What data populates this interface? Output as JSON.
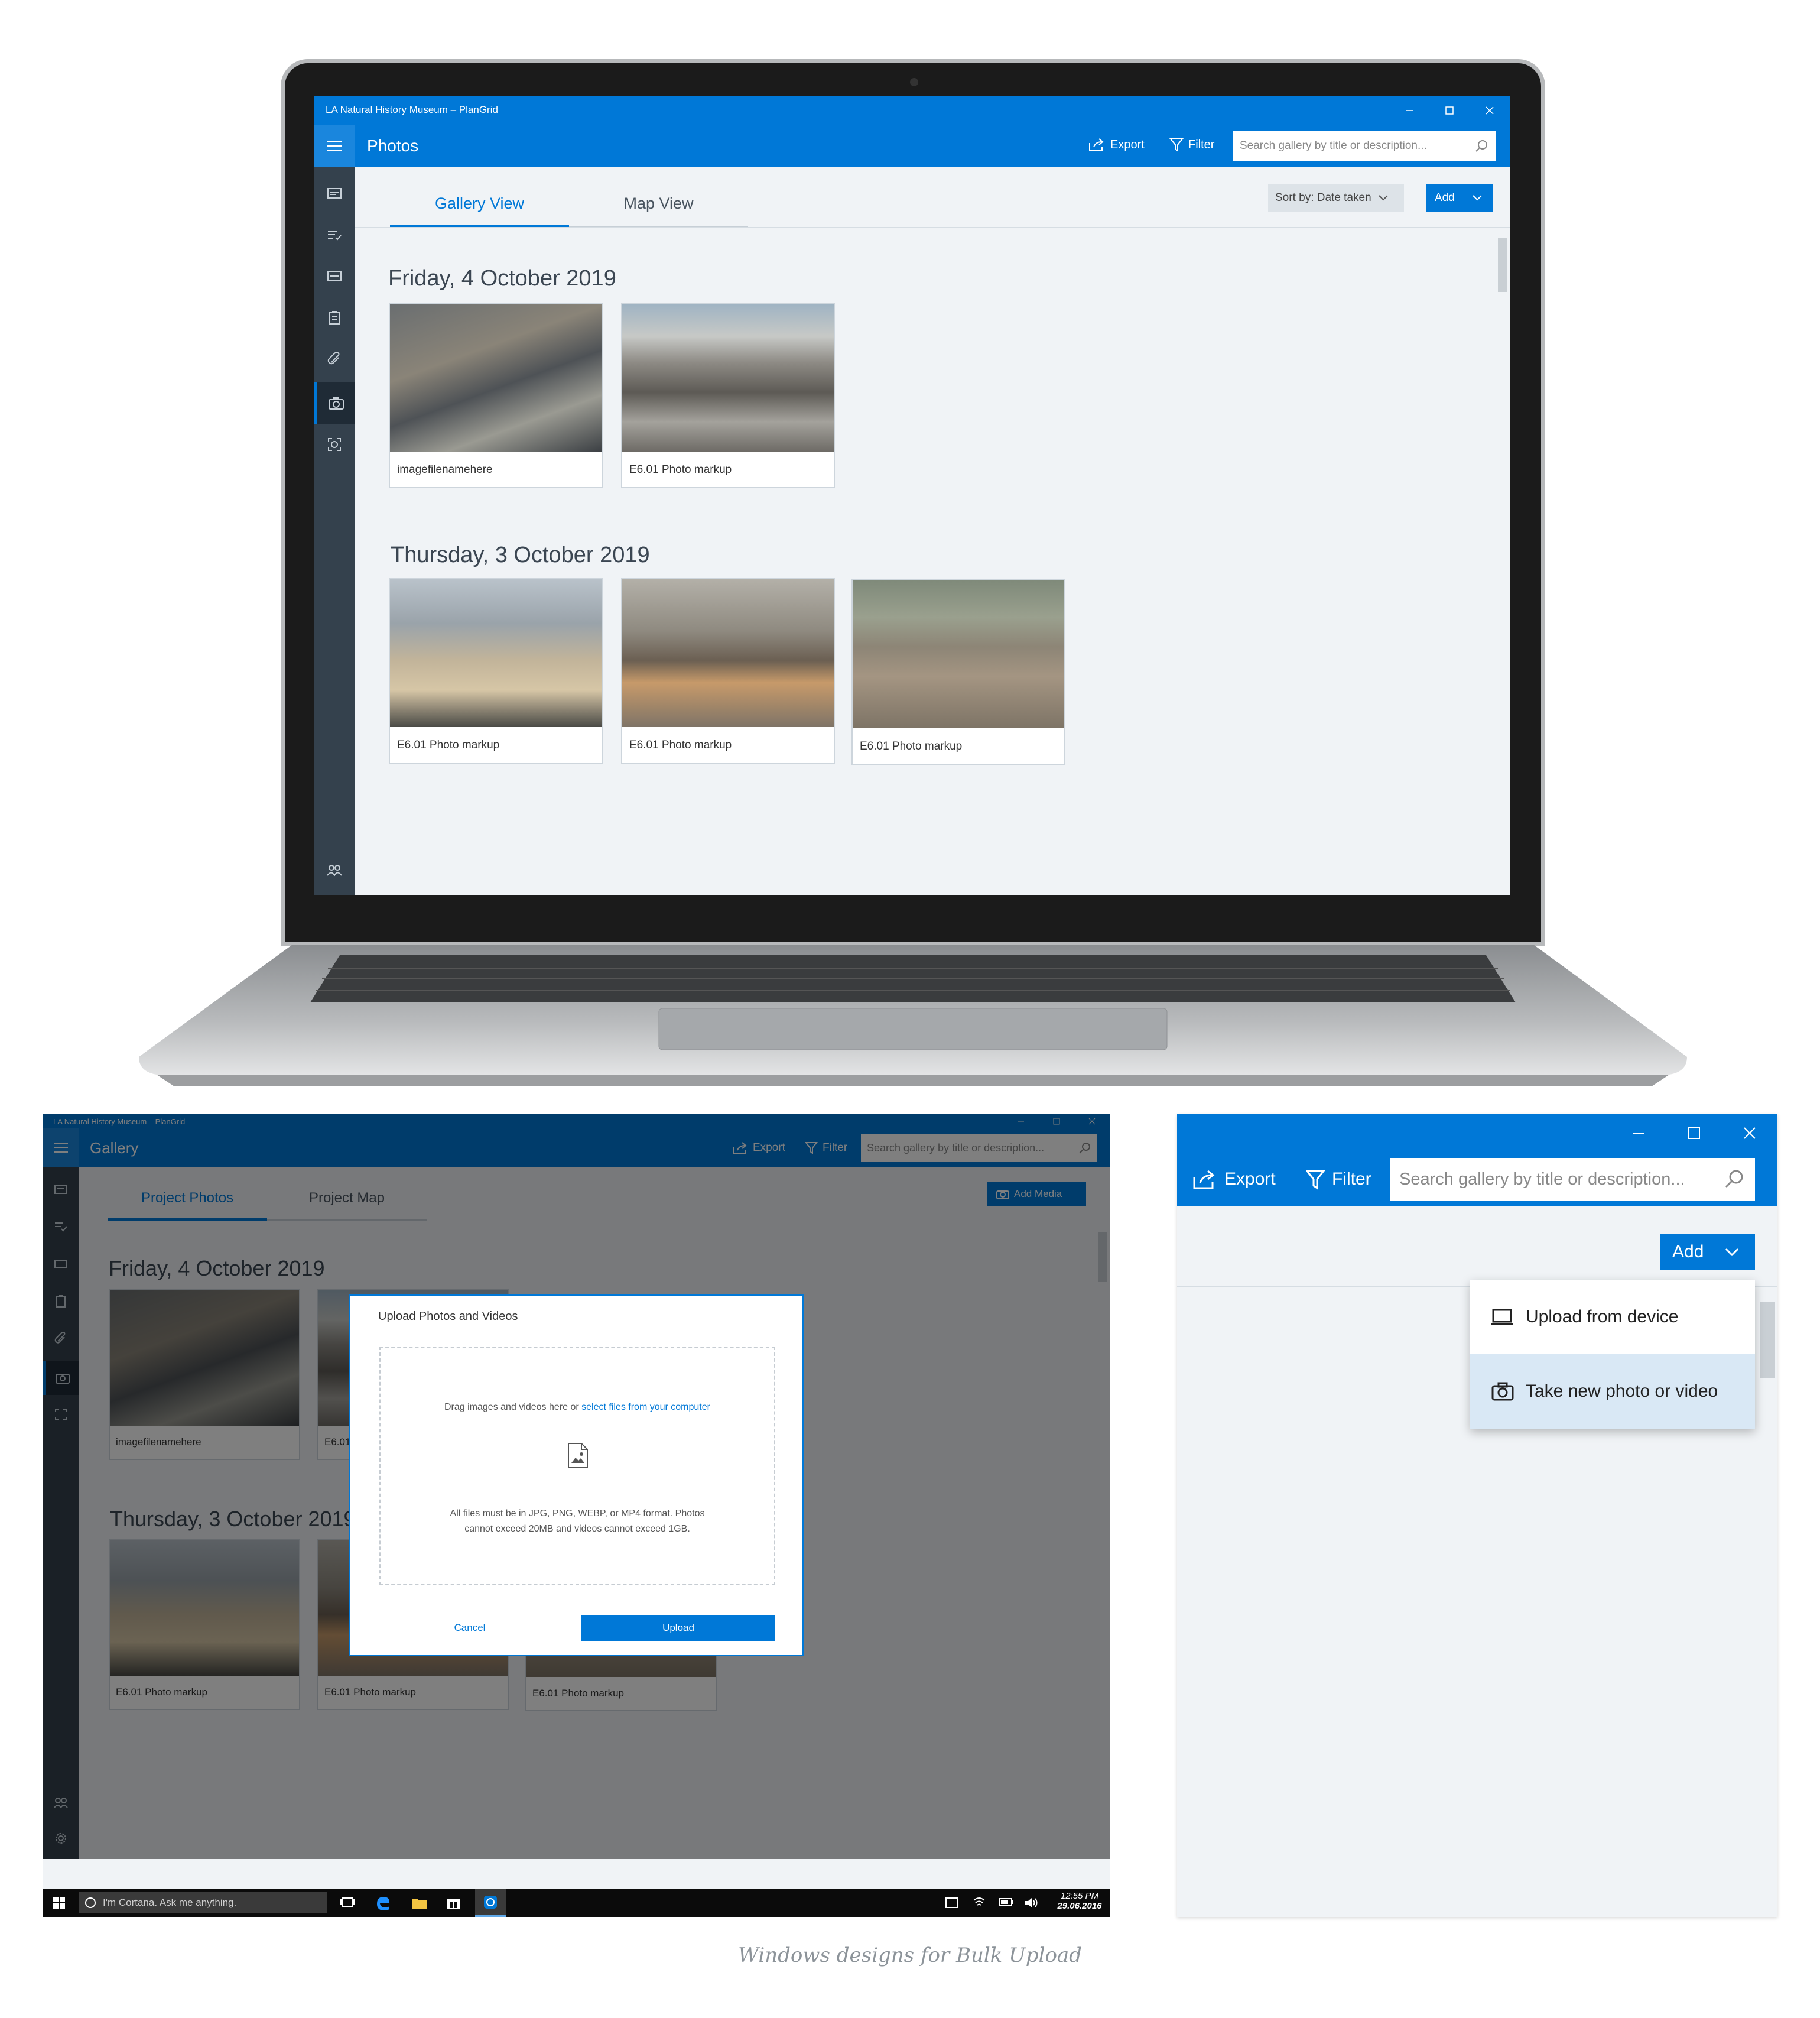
{
  "laptop": {
    "window_title": "LA Natural History Museum – PlanGrid",
    "page_title": "Photos",
    "export_label": "Export",
    "filter_label": "Filter",
    "search_placeholder": "Search gallery by title or description...",
    "tabs": [
      "Gallery View",
      "Map View"
    ],
    "sort_label": "Sort by: Date taken",
    "add_label": "Add",
    "groups": [
      {
        "date": "Friday, 4 October 2019",
        "photos": [
          "imagefilenamehere",
          "E6.01 Photo markup"
        ]
      },
      {
        "date": "Thursday, 3 October 2019",
        "photos": [
          "E6.01 Photo markup",
          "E6.01 Photo markup",
          "E6.01 Photo markup"
        ]
      }
    ]
  },
  "dialog_window": {
    "window_title": "LA Natural History Museum – PlanGrid",
    "page_title": "Gallery",
    "export_label": "Export",
    "filter_label": "Filter",
    "search_placeholder": "Search gallery by title or description...",
    "tabs": [
      "Project Photos",
      "Project Map"
    ],
    "add_media_label": "Add Media",
    "groups": [
      {
        "date": "Friday, 4 October 2019",
        "photos": [
          "imagefilenamehere",
          "E6.01"
        ]
      },
      {
        "date": "Thursday, 3 October 2019",
        "photos": [
          "E6.01 Photo markup",
          "E6.01 Photo markup",
          "E6.01 Photo markup"
        ]
      }
    ],
    "dialog": {
      "title": "Upload Photos and Videos",
      "drop_text": "Drag images and videos here or ",
      "drop_link": "select files from your computer",
      "rules_line1": "All files must be in JPG, PNG, WEBP, or MP4 format. Photos",
      "rules_line2": "cannot exceed 20MB and videos cannot exceed 1GB.",
      "cancel_label": "Cancel",
      "upload_label": "Upload"
    },
    "taskbar": {
      "cortana_placeholder": "I'm Cortana. Ask me anything.",
      "time": "12:55 PM",
      "date": "29.06.2016"
    }
  },
  "zoom_panel": {
    "export_label": "Export",
    "filter_label": "Filter",
    "search_placeholder": "Search gallery by title or description...",
    "add_label": "Add",
    "menu": [
      "Upload from device",
      "Take new photo or video"
    ]
  },
  "caption": "Windows designs for Bulk Upload",
  "colors": {
    "accent": "#0078d7",
    "rail": "#34414d",
    "content_bg": "#f0f3f6",
    "menu_hover": "#d9e8f5"
  }
}
